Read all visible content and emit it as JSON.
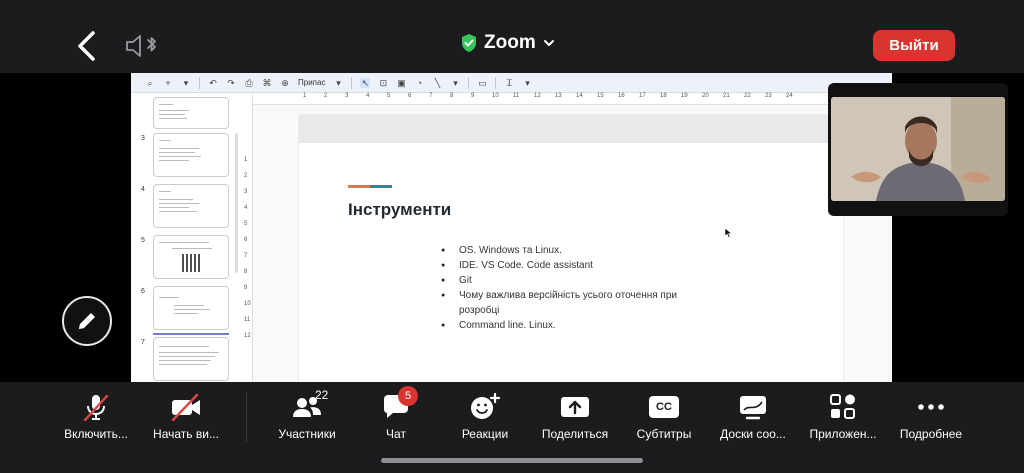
{
  "app": {
    "title": "Zoom",
    "leave_label": "Выйти"
  },
  "colors": {
    "leave": "#d9342f",
    "bar_bg": "#1c1c1e",
    "shield": "#34c759",
    "slide_title": "#1f2a33"
  },
  "editor": {
    "toolbar": {
      "zoom_label": "Припас"
    },
    "ruler_marks": [
      "1",
      "2",
      "3",
      "4",
      "5",
      "6",
      "7",
      "8",
      "9",
      "10",
      "11",
      "12",
      "13",
      "14",
      "15",
      "16",
      "17",
      "18",
      "19",
      "20",
      "21",
      "22",
      "23",
      "24"
    ],
    "vruler_marks": [
      "1",
      "2",
      "3",
      "4",
      "5",
      "6",
      "7",
      "8",
      "9",
      "10",
      "11",
      "12"
    ],
    "filmstrip": [
      {
        "num": "3"
      },
      {
        "num": "4"
      },
      {
        "num": "5"
      },
      {
        "num": "6"
      },
      {
        "num": "7"
      }
    ],
    "slide": {
      "title": "Інструменти",
      "bullets": [
        "OS. Windows та Linux.",
        "IDE. VS Code. Code assistant",
        "Git",
        "Чому важлива версійність усього оточення при розробці",
        "Command line. Linux."
      ]
    }
  },
  "toolbar_bottom": {
    "mic_label": "Включить...",
    "video_label": "Начать ви...",
    "participants_label": "Участники",
    "participants_count": "22",
    "chat_label": "Чат",
    "chat_badge": "5",
    "reactions_label": "Реакции",
    "share_label": "Поделиться",
    "subtitles_label": "Субтитры",
    "subtitles_icon_text": "CC",
    "whiteboards_label": "Доски соо...",
    "apps_label": "Приложен...",
    "more_label": "Подробнее"
  }
}
